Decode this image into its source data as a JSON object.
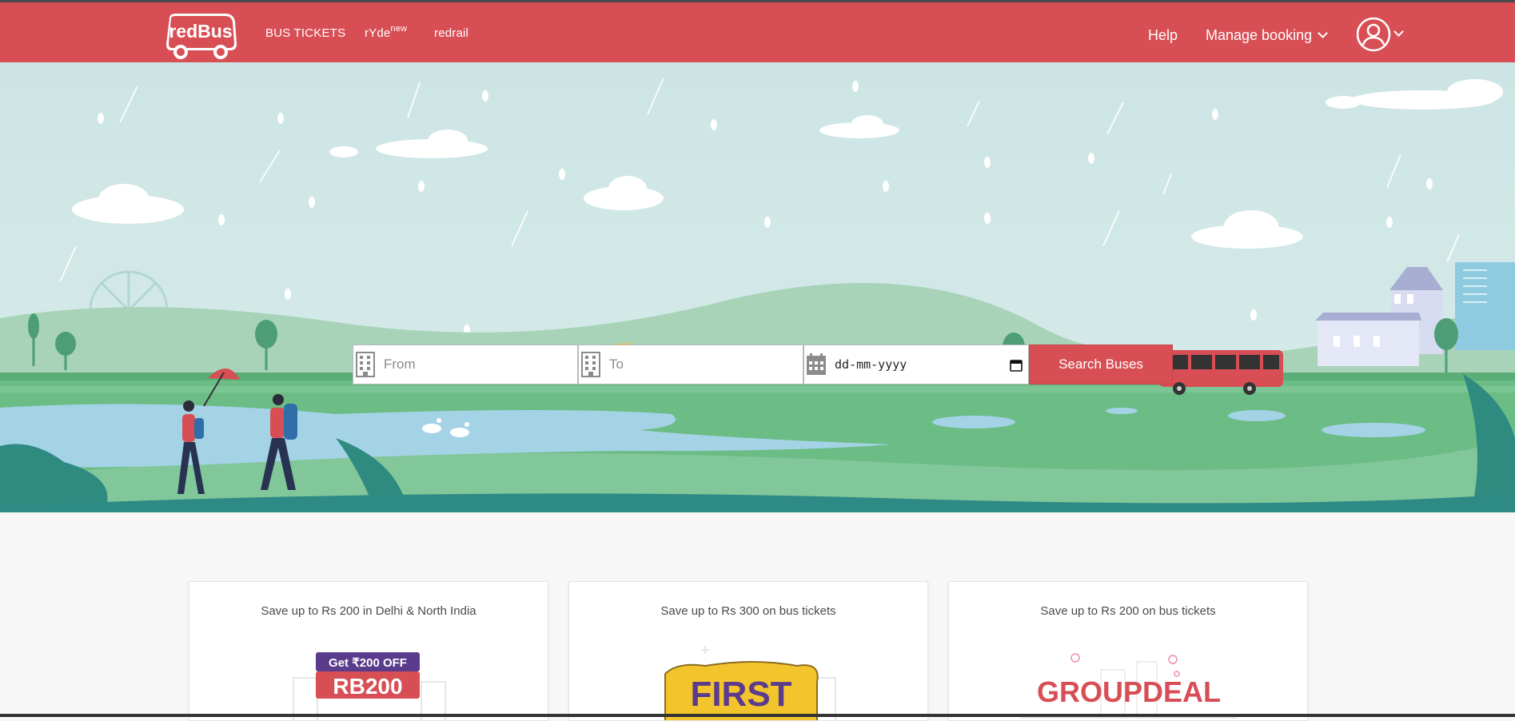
{
  "header": {
    "logo_text": "redBus",
    "nav": {
      "bus_tickets": "BUS TICKETS",
      "ryde": "rYde",
      "ryde_badge": "new",
      "redrail": "redrail"
    },
    "help": "Help",
    "manage_booking": "Manage booking"
  },
  "search": {
    "from_placeholder": "From",
    "to_placeholder": "To",
    "date_value": "dd-mm-yyyy",
    "button_label": "Search Buses"
  },
  "offers": [
    {
      "title": "Save up to Rs 200 in Delhi & North India",
      "badge_top": "Get ₹200 OFF",
      "code": "RB200"
    },
    {
      "title": "Save up to Rs 300 on bus tickets",
      "code": "FIRST"
    },
    {
      "title": "Save up to Rs 200 on bus tickets",
      "code": "GROUPDEAL"
    }
  ],
  "colors": {
    "brand_red": "#d84e55",
    "sky": "#cde6e5",
    "grass": "#7bc595",
    "water": "#9ed0e2"
  },
  "icons": [
    "building-icon",
    "calendar-icon",
    "user-icon",
    "chevron-down-icon"
  ]
}
